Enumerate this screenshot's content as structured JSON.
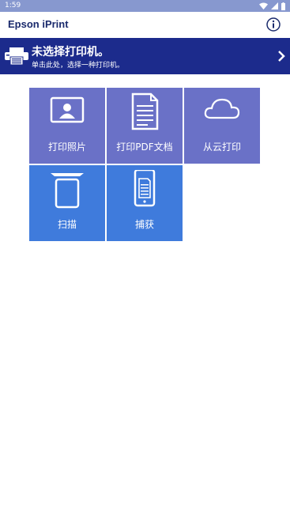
{
  "status_bar": {
    "time": "1:59"
  },
  "app_bar": {
    "title": "Epson iPrint"
  },
  "printer_banner": {
    "title": "未选择打印机。",
    "subtitle": "单击此处，选择一种打印机。"
  },
  "tiles": [
    {
      "label": "打印照片",
      "icon": "photo-icon"
    },
    {
      "label": "打印PDF文档",
      "icon": "document-icon"
    },
    {
      "label": "从云打印",
      "icon": "cloud-icon"
    },
    {
      "label": "扫描",
      "icon": "scanner-icon"
    },
    {
      "label": "捕获",
      "icon": "phone-document-icon"
    }
  ],
  "colors": {
    "status_bar": "#8798cf",
    "banner": "#1c2b8c",
    "tile_purple": "#6a71c7",
    "tile_blue": "#3f7bdc",
    "title": "#1a2a6c"
  }
}
